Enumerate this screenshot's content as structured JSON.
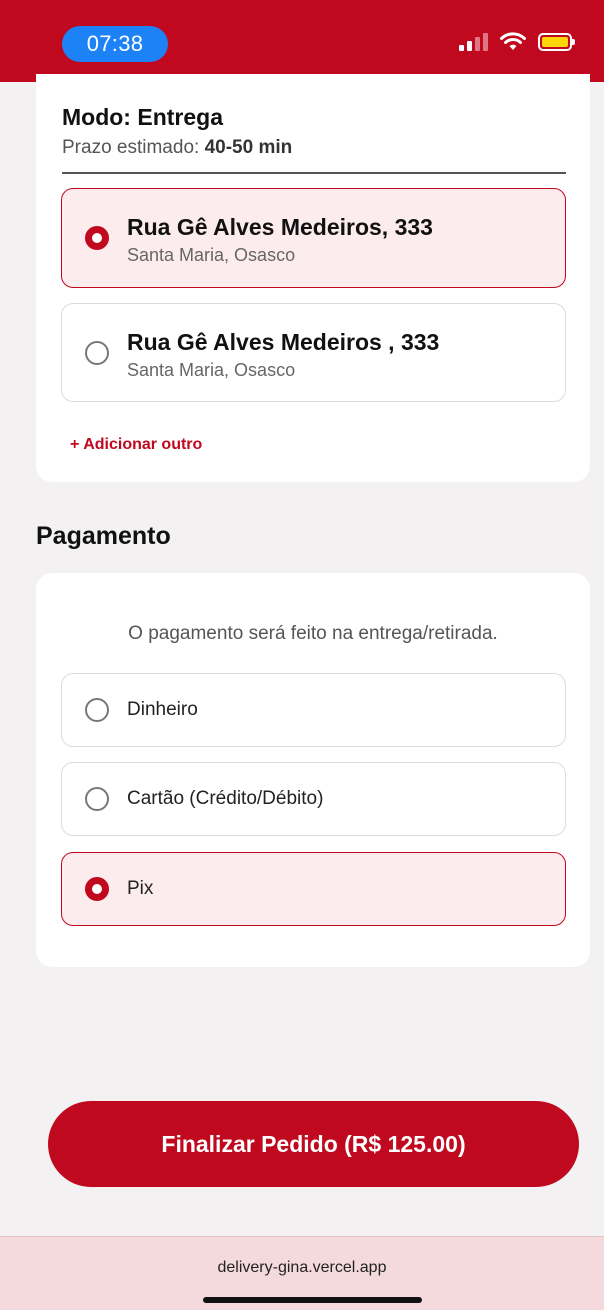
{
  "status_bar": {
    "time": "07:38",
    "signal_icon": "cellular-signal-icon",
    "wifi_icon": "wifi-icon",
    "battery_icon": "battery-icon",
    "battery_color": "#ffd60a",
    "background_color": "#c0081f"
  },
  "delivery": {
    "mode_title": "Modo: Entrega",
    "estimate_label": "Prazo estimado:",
    "estimate_value": "40-50 min",
    "addresses": [
      {
        "street": "Rua Gê Alves Medeiros, 333",
        "city": "Santa Maria, Osasco",
        "selected": true
      },
      {
        "street": "Rua Gê Alves Medeiros , 333",
        "city": "Santa Maria, Osasco",
        "selected": false
      }
    ],
    "add_other_label": "+ Adicionar outro"
  },
  "payment": {
    "section_title": "Pagamento",
    "info": "O pagamento será feito na entrega/retirada.",
    "options": [
      {
        "label": "Dinheiro",
        "selected": false
      },
      {
        "label": "Cartão (Crédito/Débito)",
        "selected": false
      },
      {
        "label": "Pix",
        "selected": true
      }
    ]
  },
  "finalize_button": {
    "label": "Finalizar Pedido (R$ 125.00)"
  },
  "browser": {
    "url": "delivery-gina.vercel.app"
  },
  "colors": {
    "accent": "#c0081f",
    "selected_background": "#fdecee",
    "page_background": "#f3f1f1"
  }
}
